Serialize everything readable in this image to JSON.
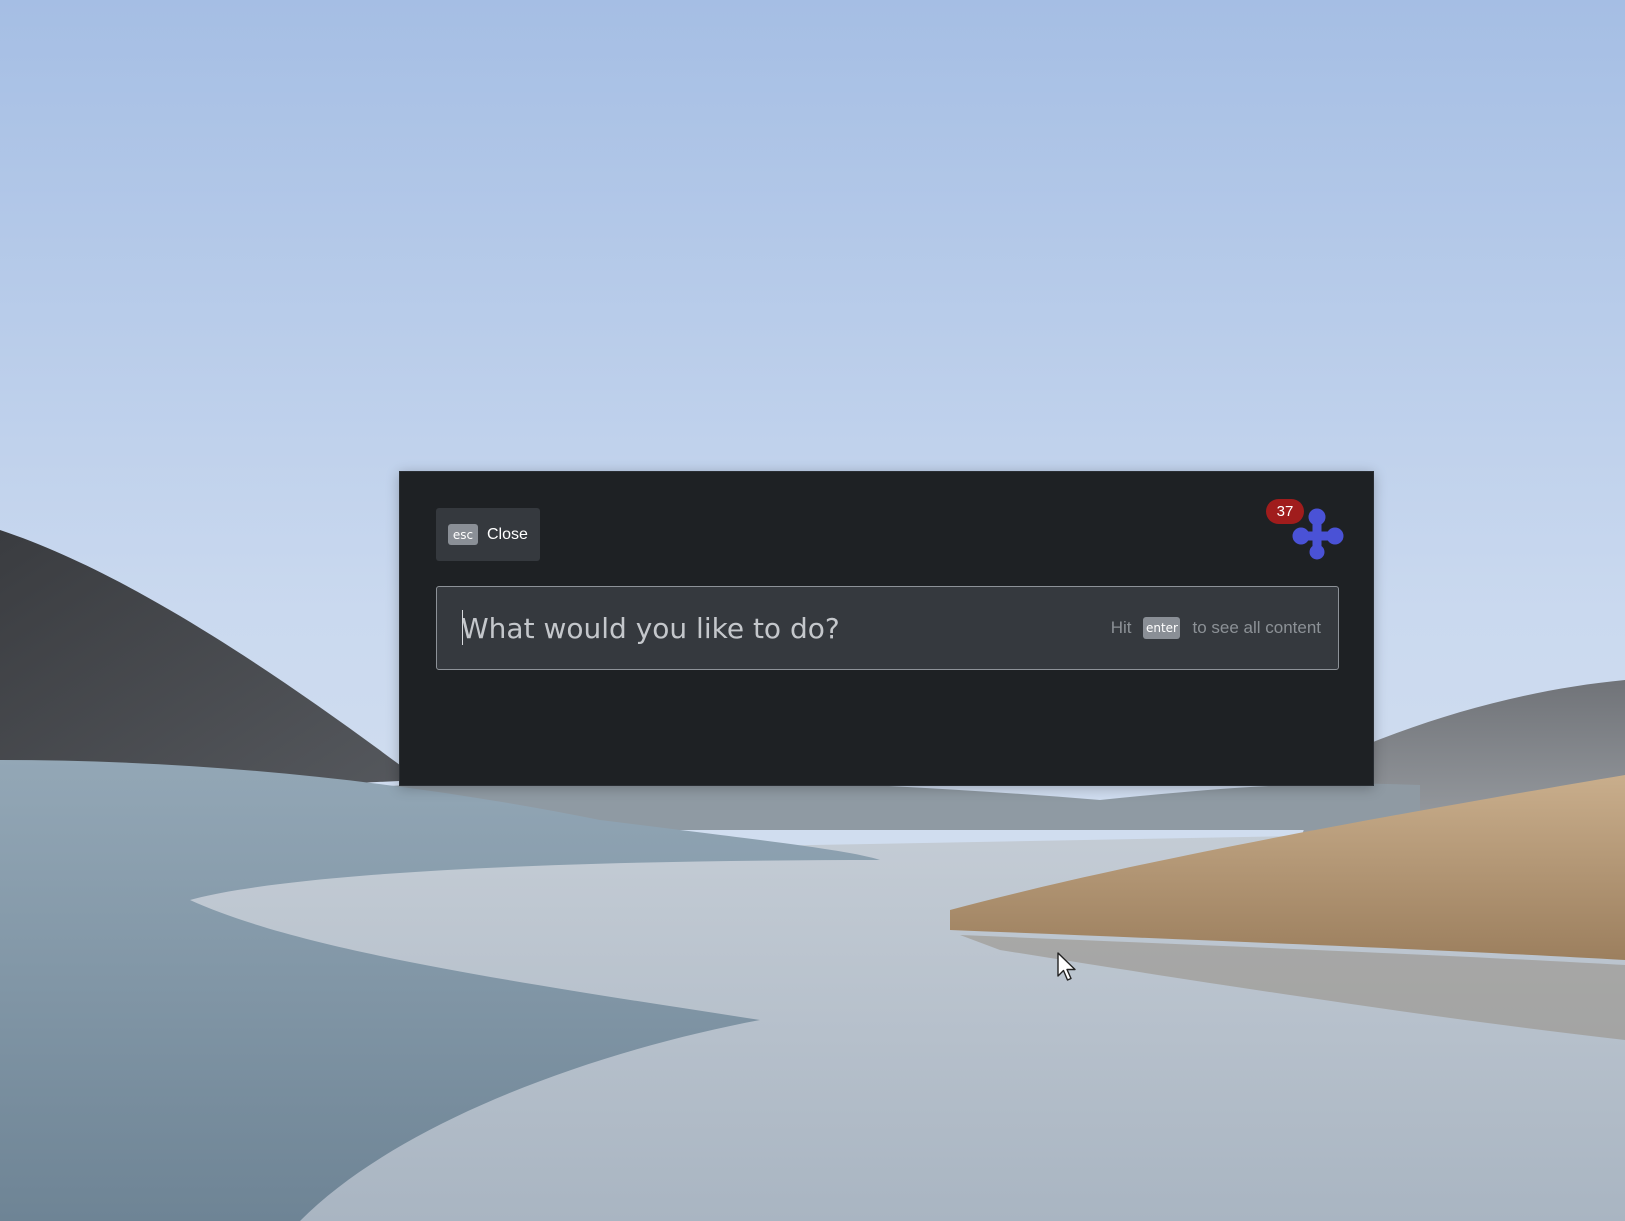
{
  "palette": {
    "close_button": {
      "key_label": "esc",
      "label": "Close"
    },
    "logo": {
      "icon": "molecule-logo-icon",
      "color": "#4a52d6",
      "badge_count": "37",
      "badge_color": "#a01c1c"
    },
    "search": {
      "value": "",
      "placeholder": "What would you like to do?",
      "hint_prefix": "Hit",
      "hint_key": "enter",
      "hint_suffix": "to see all content"
    }
  },
  "colors": {
    "panel_bg": "#1e2124",
    "input_bg": "#35393e",
    "accent": "#4a52d6"
  }
}
